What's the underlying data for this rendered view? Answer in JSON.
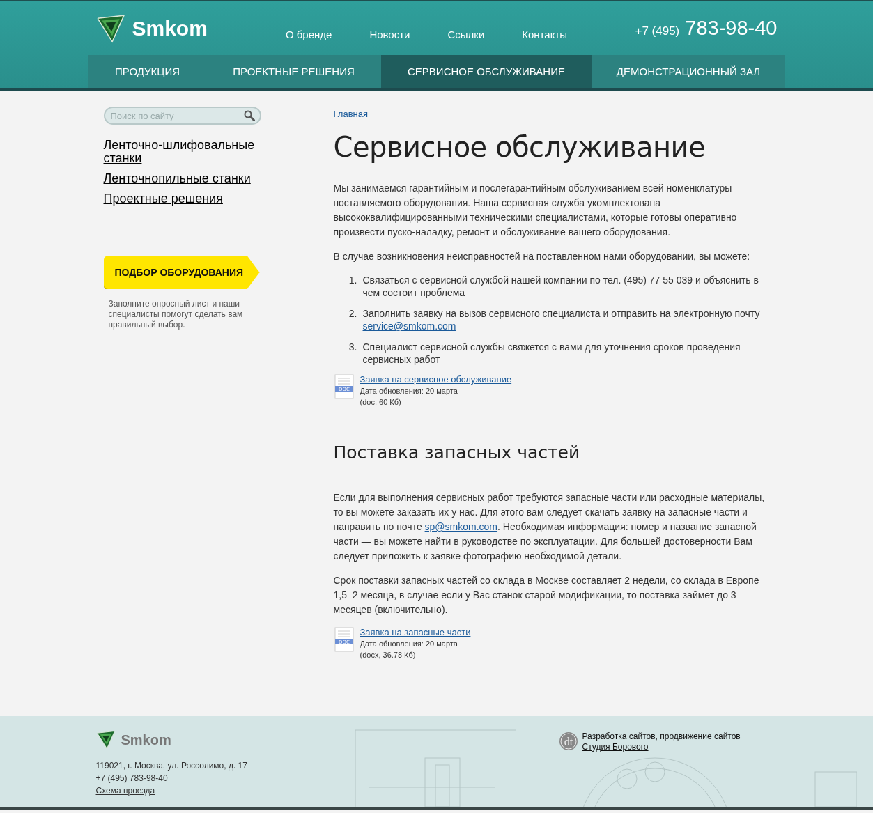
{
  "header": {
    "logo_text": "Smkom",
    "nav_links": [
      "О бренде",
      "Новости",
      "Ссылки",
      "Контакты"
    ],
    "phone_prefix": "+7 (495)",
    "phone_number": "783-98-40",
    "menu": [
      {
        "label": "ПРОДУКЦИЯ",
        "selected": false
      },
      {
        "label": "ПРОЕКТНЫЕ РЕШЕНИЯ",
        "selected": false
      },
      {
        "label": "СЕРВИСНОЕ ОБСЛУЖИВАНИЕ",
        "selected": true
      },
      {
        "label": "ДЕМОНСТРАЦИОННЫЙ ЗАЛ",
        "selected": false
      }
    ]
  },
  "sidebar": {
    "search": {
      "placeholder": "Поиск по сайту"
    },
    "links": [
      "Ленточно-шлифовальные станки",
      "Ленточнопильные станки",
      "Проектные решения"
    ],
    "cta_button": "ПОДБОР ОБОРУДОВАНИЯ",
    "cta_note": "Заполните опросный лист и наши специалисты помогут сделать вам правильный выбор."
  },
  "main": {
    "breadcrumb": "Главная",
    "title": "Сервисное обслуживание",
    "sections": [
      {
        "paragraphs": [
          [
            {
              "kind": "text",
              "text": "Мы занимаемся гарантийным и послегарантийным обслуживанием всей номенклатуры поставляемого оборудования. Наша сервисная служба укомплектована высококвалифицированными техническими специалистами, которые готовы оперативно произвести пуско-наладку, ремонт и обслуживание вашего оборудования."
            }
          ],
          [
            {
              "kind": "text",
              "text": "В случае возникновения неисправностей на поставленном нами оборудовании, вы можете:"
            }
          ]
        ],
        "steps": [
          {
            "marker": "1.",
            "parts": [
              {
                "kind": "text",
                "text": "Связаться с сервисной службой нашей компании по тел. (495) 77 55 039 и объяснить в чем состоит проблема"
              }
            ]
          },
          {
            "marker": "2.",
            "parts": [
              {
                "kind": "text",
                "text": "Заполнить заявку на вызов сервисного специалиста и отправить на электронную почту "
              },
              {
                "kind": "link",
                "text": "service@smkom.com"
              }
            ]
          },
          {
            "marker": "3.",
            "parts": [
              {
                "kind": "text",
                "text": "Специалист сервисной службы свяжется с вами для уточнения сроков проведения сервисных работ"
              }
            ]
          }
        ],
        "document": {
          "icon_label": "DOC",
          "title": "Заявка на сервисное обслуживание",
          "updated": "Дата обновления: 20 марта",
          "info": "(doc, 60 Кб)"
        }
      },
      {
        "heading": "Поставка запасных частей",
        "paragraphs": [
          [
            {
              "kind": "text",
              "text": "Если для выполнения сервисных работ требуются запасные части или расходные материалы, то вы можете заказать их у нас. Для этого вам следует скачать заявку на запасные части и направить по почте "
            },
            {
              "kind": "link",
              "text": "sp@smkom.com"
            },
            {
              "kind": "text",
              "text": ". Необходимая информация: номер и название запасной части — вы можете найти в руководстве по эксплуатации. Для большей достоверности Вам следует приложить к заявке фотографию необходимой детали."
            }
          ],
          [
            {
              "kind": "text",
              "text": "Срок поставки запасных частей со склада в Москве составляет 2 недели, со склада в Европе 1,5–2 месяца, в случае если у Вас станок старой модификации, то поставка займет до 3 месяцев (включительно)."
            }
          ]
        ],
        "document": {
          "icon_label": "DOC",
          "title": "Заявка на запасные части",
          "updated": "Дата обновления: 20 марта",
          "info": "(docx, 36.78 Кб)"
        }
      }
    ]
  },
  "footer": {
    "logo_text": "Smkom",
    "address": "119021, г. Москва, ул. Россолимо, д. 17",
    "phone": "+7 (495) 783-98-40",
    "map_link": "Схема проезда",
    "dev_logo_text": "dt",
    "dev_text": "Разработка сайтов, продвижение сайтов",
    "dev_link": "Студия Борового"
  }
}
